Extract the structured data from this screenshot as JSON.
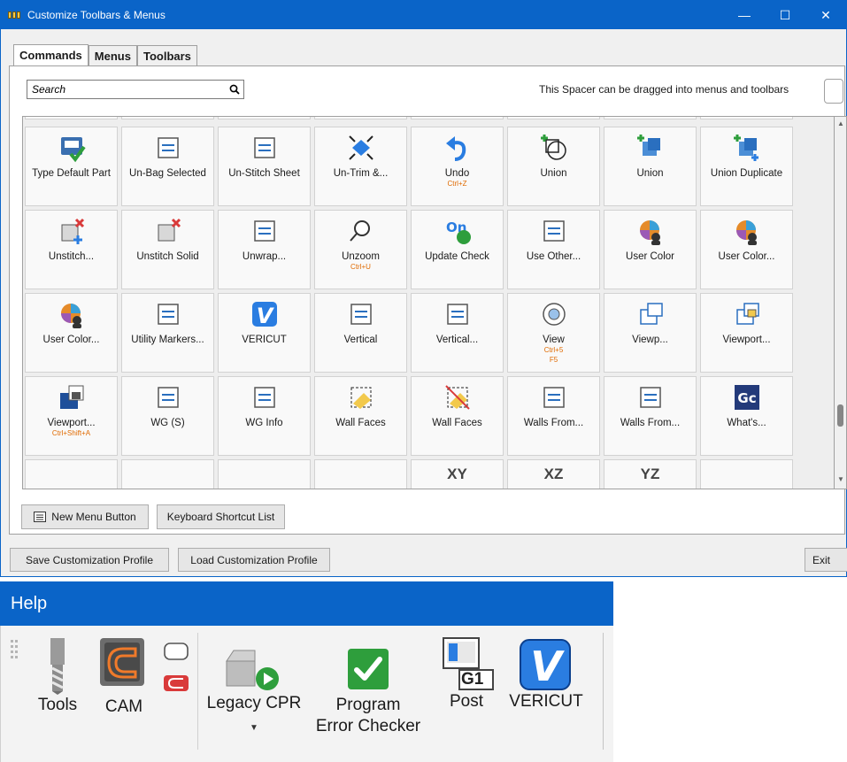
{
  "window": {
    "title": "Customize Toolbars & Menus",
    "minimize_glyph": "—",
    "maximize_glyph": "☐",
    "close_glyph": "✕"
  },
  "tabs": [
    {
      "label": "Commands",
      "active": true
    },
    {
      "label": "Menus",
      "active": false
    },
    {
      "label": "Toolbars",
      "active": false
    }
  ],
  "search": {
    "placeholder": "Search"
  },
  "spacer_hint": "This Spacer can be dragged into menus and toolbars",
  "commands": [
    {
      "label": "Type Default Part",
      "shortcut": "",
      "shortcut2": "",
      "icon": "default-part-icon"
    },
    {
      "label": "Un-Bag Selected",
      "shortcut": "",
      "shortcut2": "",
      "icon": "unbag-icon"
    },
    {
      "label": "Un-Stitch Sheet",
      "shortcut": "",
      "shortcut2": "",
      "icon": "unstitch-sheet-icon"
    },
    {
      "label": "Un-Trim &...",
      "shortcut": "",
      "shortcut2": "",
      "icon": "untrim-icon"
    },
    {
      "label": "Undo",
      "shortcut": "Ctrl+Z",
      "shortcut2": "",
      "icon": "undo-icon"
    },
    {
      "label": "Union",
      "shortcut": "",
      "shortcut2": "",
      "icon": "union-circle-icon"
    },
    {
      "label": "Union",
      "shortcut": "",
      "shortcut2": "",
      "icon": "union-box-icon"
    },
    {
      "label": "Union Duplicate",
      "shortcut": "",
      "shortcut2": "",
      "icon": "union-duplicate-icon"
    },
    {
      "label": "Unstitch...",
      "shortcut": "",
      "shortcut2": "",
      "icon": "unstitch-icon"
    },
    {
      "label": "Unstitch Solid",
      "shortcut": "",
      "shortcut2": "",
      "icon": "unstitch-solid-icon"
    },
    {
      "label": "Unwrap...",
      "shortcut": "",
      "shortcut2": "",
      "icon": "unwrap-icon"
    },
    {
      "label": "Unzoom",
      "shortcut": "Ctrl+U",
      "shortcut2": "",
      "icon": "unzoom-icon"
    },
    {
      "label": "Update Check",
      "shortcut": "",
      "shortcut2": "",
      "icon": "update-check-icon"
    },
    {
      "label": "Use Other...",
      "shortcut": "",
      "shortcut2": "",
      "icon": "use-other-icon"
    },
    {
      "label": "User Color",
      "shortcut": "",
      "shortcut2": "",
      "icon": "user-color-icon"
    },
    {
      "label": "User Color...",
      "shortcut": "",
      "shortcut2": "",
      "icon": "user-color-select-icon"
    },
    {
      "label": "User Color...",
      "shortcut": "",
      "shortcut2": "",
      "icon": "user-color-box-icon"
    },
    {
      "label": "Utility Markers...",
      "shortcut": "",
      "shortcut2": "",
      "icon": "utility-markers-icon"
    },
    {
      "label": "VERICUT",
      "shortcut": "",
      "shortcut2": "",
      "icon": "vericut-icon"
    },
    {
      "label": "Vertical",
      "shortcut": "",
      "shortcut2": "",
      "icon": "vertical-icon"
    },
    {
      "label": "Vertical...",
      "shortcut": "",
      "shortcut2": "",
      "icon": "vertical-arrow-icon"
    },
    {
      "label": "View",
      "shortcut": "Ctrl+5",
      "shortcut2": "F5",
      "icon": "view-icon"
    },
    {
      "label": "Viewp...",
      "shortcut": "",
      "shortcut2": "",
      "icon": "viewport-icon"
    },
    {
      "label": "Viewport...",
      "shortcut": "",
      "shortcut2": "",
      "icon": "viewport-lock-icon"
    },
    {
      "label": "Viewport...",
      "shortcut": "Ctrl+Shift+A",
      "shortcut2": "",
      "icon": "viewport-lock-blue-icon"
    },
    {
      "label": "WG (S)",
      "shortcut": "",
      "shortcut2": "",
      "icon": "wg-icon"
    },
    {
      "label": "WG Info",
      "shortcut": "",
      "shortcut2": "",
      "icon": "wg-info-icon"
    },
    {
      "label": "Wall Faces",
      "shortcut": "",
      "shortcut2": "",
      "icon": "wall-faces-icon"
    },
    {
      "label": "Wall Faces",
      "shortcut": "",
      "shortcut2": "",
      "icon": "wall-faces-remove-icon"
    },
    {
      "label": "Walls From...",
      "shortcut": "",
      "shortcut2": "",
      "icon": "walls-from-icon"
    },
    {
      "label": "Walls From...",
      "shortcut": "",
      "shortcut2": "",
      "icon": "walls-from-outline-icon"
    },
    {
      "label": "What's...",
      "shortcut": "",
      "shortcut2": "",
      "icon": "whats-new-icon"
    }
  ],
  "partial_row": [
    "",
    "",
    "",
    "",
    "XY",
    "XZ",
    "YZ",
    ""
  ],
  "buttons": {
    "new_menu": "New Menu Button",
    "keyboard_list": "Keyboard Shortcut List",
    "save_profile": "Save Customization Profile",
    "load_profile": "Load Customization Profile",
    "exit": "Exit"
  },
  "ribbon": {
    "title": "Help",
    "items": [
      {
        "label": "Tools",
        "icon": "end-mill-icon"
      },
      {
        "label": "CAM",
        "icon": "cam-icon"
      },
      {
        "label": "Legacy CPR",
        "icon": "legacy-cpr-icon"
      },
      {
        "label": "Program\nError Checker",
        "icon": "program-error-checker-icon"
      },
      {
        "label": "Post",
        "icon": "post-icon"
      },
      {
        "label": "VERICUT",
        "icon": "vericut-icon"
      }
    ],
    "g1_text": "G1",
    "vericut_letter": "V",
    "gc_text": "Gc"
  },
  "colors": {
    "titlebar": "#0a64c8",
    "shortcut": "#e06a00",
    "vericut": "#2a7de1",
    "check_green": "#2e9e3c"
  }
}
